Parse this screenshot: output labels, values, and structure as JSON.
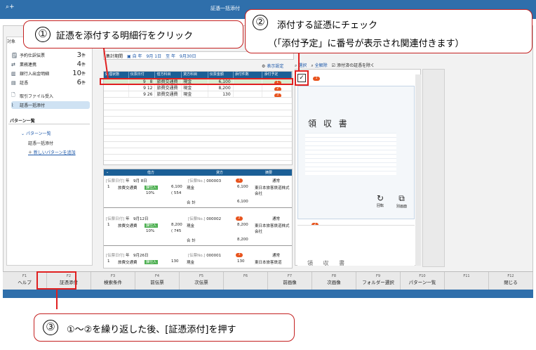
{
  "window": {
    "title": "証憑一括添付",
    "help_icon": "search-help-icon"
  },
  "sidebar": {
    "header": "対象",
    "items": [
      {
        "label": "予約仕訳伝票",
        "count": "3",
        "unit": "件",
        "icon": "clock-doc-icon"
      },
      {
        "label": "業務連携",
        "count": "4",
        "unit": "件",
        "icon": "sync-icon"
      },
      {
        "label": "銀行入出金明細",
        "count": "10",
        "unit": "件",
        "icon": "bank-icon"
      },
      {
        "label": "証憑",
        "count": "6",
        "unit": "件",
        "icon": "document-icon"
      },
      {
        "label": "取引ファイル受入",
        "count": "",
        "unit": "",
        "icon": "file-import-icon"
      },
      {
        "label": "証憑一括添付",
        "count": "",
        "unit": "",
        "icon": "paperclip-icon"
      }
    ],
    "pattern_header": "パターン一覧",
    "pattern_group": "パターン一覧",
    "pattern_item": "証憑一括添付",
    "pattern_add": "新しいパターンを追加"
  },
  "period": {
    "label": "集計期間",
    "from": "自",
    "from_date": "年　9月 1日",
    "to": "至",
    "to_date": "年　9月30日"
  },
  "display_settings": "表示設定",
  "grid": {
    "columns": [
      "処理状態",
      "伝票日付",
      "借方科目",
      "貸方科目",
      "伝票金額",
      "添付件数",
      "添付予定"
    ],
    "rows": [
      {
        "date": "9　8",
        "debit": "旅費交通費",
        "credit": "現金",
        "amount": "6,100",
        "plan": "1"
      },
      {
        "date": "9 12",
        "debit": "旅費交通費",
        "credit": "現金",
        "amount": "8,200",
        "plan": "2"
      },
      {
        "date": "9 26",
        "debit": "旅費交通費",
        "credit": "現金",
        "amount": "130",
        "plan": "3"
      }
    ]
  },
  "detail": {
    "headers": [
      "借方",
      "貸方",
      "摘要"
    ],
    "entries": [
      {
        "date": "年　9月 8日",
        "no": "000003",
        "plan": "1",
        "type": "通常",
        "debit": "旅費交通費",
        "tax": "課仕入",
        "amount": "6,100",
        "rate": "10%",
        "tax_amount": "( 554",
        "credit": "現金",
        "credit_amount": "6,100",
        "memo": "東日本旅客鉄道株式会社",
        "total_label": "合 計",
        "total": "6,100"
      },
      {
        "date": "年　9月12日",
        "no": "000002",
        "plan": "2",
        "type": "通常",
        "debit": "旅費交通費",
        "tax": "課仕入",
        "amount": "8,200",
        "rate": "10%",
        "tax_amount": "( 745",
        "credit": "現金",
        "credit_amount": "8,200",
        "memo": "東日本旅客鉄道株式会社",
        "total_label": "合 計",
        "total": "8,200"
      },
      {
        "date": "年　9月26日",
        "no": "000001",
        "plan": "3",
        "type": "通常",
        "debit": "旅費交通費",
        "tax": "課仕入",
        "amount": "130",
        "credit": "現金",
        "credit_amount": "130",
        "memo": "東日本旅客鉄道"
      }
    ]
  },
  "right_toolbar": {
    "select": "選択",
    "deselect_all": "全解除",
    "exclude_label": "添付済の証憑を除く"
  },
  "receipt": {
    "title": "領 収 書",
    "badge1": "1",
    "badge2": "2",
    "rotate": "回転",
    "separate": "別画面",
    "shrink": "縮小",
    "bottom_title": "領 収 書"
  },
  "fkeys": [
    {
      "n": "F1",
      "l": "ヘルプ"
    },
    {
      "n": "F2",
      "l": "証憑添付"
    },
    {
      "n": "F3",
      "l": "検索条件"
    },
    {
      "n": "F4",
      "l": "前伝票"
    },
    {
      "n": "F5",
      "l": "次伝票"
    },
    {
      "n": "F6",
      "l": ""
    },
    {
      "n": "F7",
      "l": "前画像"
    },
    {
      "n": "F8",
      "l": "次画像"
    },
    {
      "n": "F9",
      "l": "フォルダー選択"
    },
    {
      "n": "F10",
      "l": "パターン一覧"
    },
    {
      "n": "F11",
      "l": ""
    },
    {
      "n": "F12",
      "l": "閉じる"
    }
  ],
  "callouts": {
    "c1_num": "①",
    "c1_text": "証憑を添付する明細行をクリック",
    "c2_num": "②",
    "c2_text": "添付する証憑にチェック",
    "c2_sub": "（「添付予定」に番号が表示され関連付きます）",
    "c3_num": "③",
    "c3_text": "①～②を繰り返した後、[証憑添付]を押す"
  }
}
